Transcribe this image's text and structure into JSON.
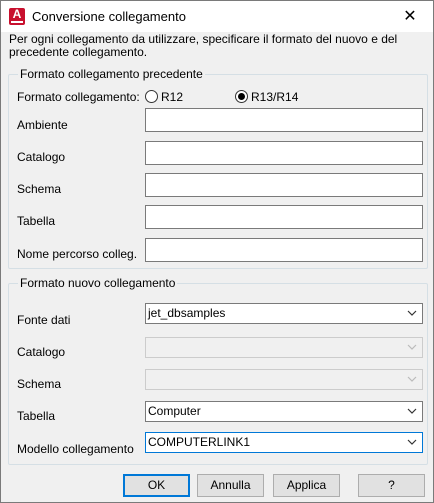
{
  "window": {
    "title": "Conversione collegamento",
    "close_label": "✕",
    "app_icon_letter": "A"
  },
  "intro": "Per ogni collegamento da utilizzare, specificare il formato del nuovo e del precedente collegamento.",
  "previous": {
    "legend": "Formato collegamento precedente",
    "format_label": "Formato collegamento:",
    "radio_r12": "R12",
    "radio_r13": "R13/R14",
    "selected": "R13/R14",
    "ambiente_label": "Ambiente",
    "catalogo_label": "Catalogo",
    "schema_label": "Schema",
    "tabella_label": "Tabella",
    "percorso_label": "Nome percorso colleg.",
    "ambiente_value": "",
    "catalogo_value": "",
    "schema_value": "",
    "tabella_value": "",
    "percorso_value": ""
  },
  "new": {
    "legend": "Formato nuovo collegamento",
    "fonte_label": "Fonte dati",
    "fonte_value": "jet_dbsamples",
    "catalogo_label": "Catalogo",
    "catalogo_value": "",
    "schema_label": "Schema",
    "schema_value": "",
    "tabella_label": "Tabella",
    "tabella_value": "Computer",
    "modello_label": "Modello collegamento",
    "modello_value": "COMPUTERLINK1"
  },
  "buttons": {
    "ok": "OK",
    "annulla": "Annulla",
    "applica": "Applica",
    "help": "?"
  },
  "colors": {
    "accent": "#0078d7",
    "app_icon": "#c8102e"
  }
}
